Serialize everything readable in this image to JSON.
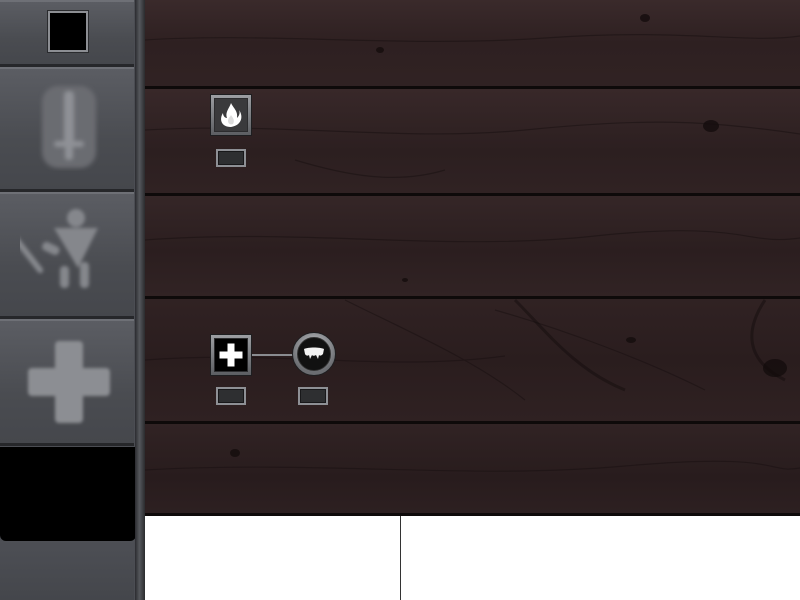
{
  "sidebar": {
    "color_swatch": {
      "color": "#000000"
    },
    "categories": [
      {
        "id": "weapon",
        "icon": "sword-icon"
      },
      {
        "id": "combat",
        "icon": "warrior-icon"
      },
      {
        "id": "healing",
        "icon": "plus-icon"
      }
    ]
  },
  "skill_tree": {
    "nodes": [
      {
        "id": "fire",
        "icon": "flame-icon",
        "shape": "square",
        "level": ""
      },
      {
        "id": "heal",
        "icon": "cross-icon",
        "shape": "square",
        "level": ""
      },
      {
        "id": "fangs",
        "icon": "fangs-icon",
        "shape": "round",
        "level": ""
      }
    ],
    "links": [
      {
        "from": "heal",
        "to": "fangs"
      }
    ]
  },
  "panels": {
    "left": {
      "text": ""
    },
    "right": {
      "text": ""
    }
  },
  "colors": {
    "wood": "#2f2122",
    "plank_gap": "#0e0a0a",
    "sidebar": "#4b4d53",
    "frame": "#8e9095"
  }
}
